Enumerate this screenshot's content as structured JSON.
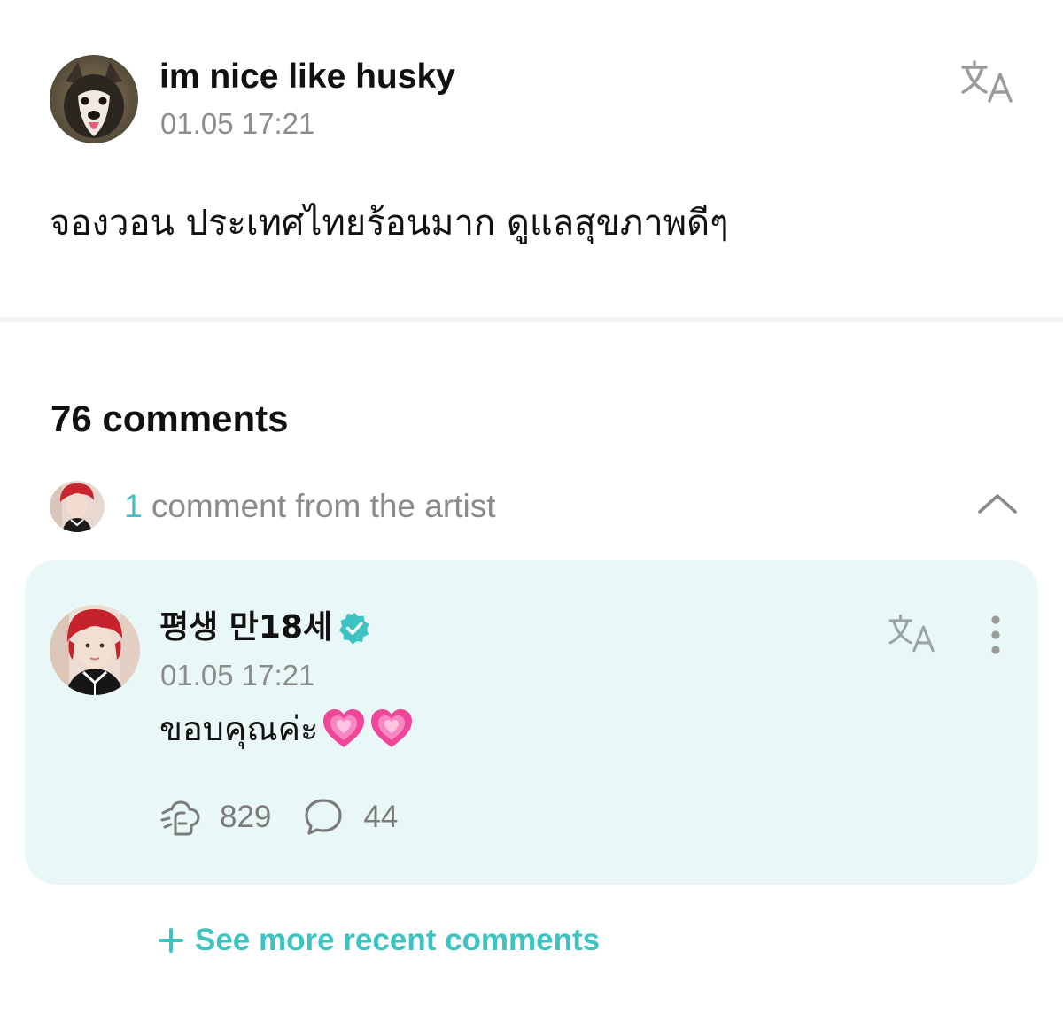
{
  "post": {
    "author": "im nice like husky",
    "timestamp": "01.05 17:21",
    "body": "จองวอน ประเทศไทยร้อนมาก ดูแลสุขภาพดีๆ",
    "avatar_icon": "husky-dog-avatar",
    "translate_icon": "translate-icon"
  },
  "comments": {
    "heading": "76 comments",
    "artist_summary": {
      "count": "1",
      "label": "comment from the artist",
      "chevron_icon": "chevron-up-icon"
    },
    "artist_comment": {
      "author": "평생 만18세",
      "verified": true,
      "timestamp": "01.05 17:21",
      "body": "ขอบคุณค่ะ",
      "emoji": [
        "growing-heart",
        "growing-heart"
      ],
      "likes": "829",
      "replies": "44",
      "card_color": "#e9f8f6"
    },
    "see_more": {
      "label": "See more recent comments"
    }
  },
  "colors": {
    "accent": "#3ec3c3",
    "muted_text": "#8c8c8c",
    "heart_pink": "#f0479b"
  }
}
